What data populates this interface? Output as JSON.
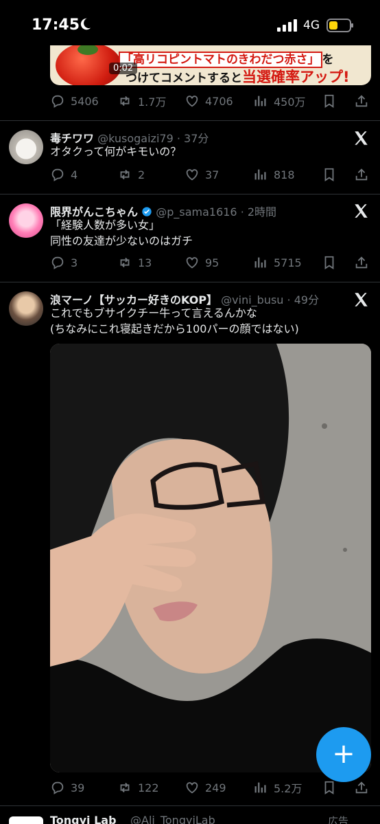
{
  "status": {
    "time": "17:45",
    "network": "4G"
  },
  "ad_tweet": {
    "image_line1_highlight": "「高リコピントマトのきわだつ赤さ」",
    "image_line1_tail": "を",
    "image_line2_pre": "つけてコメントすると",
    "image_line2_big": "当選確率アップ!",
    "video_duration": "0:02",
    "stats": {
      "replies": "5406",
      "reposts": "1.7万",
      "likes": "4706",
      "views": "450万"
    }
  },
  "tweets": [
    {
      "name": "毒チワワ",
      "handle": "@kusogaizi79",
      "time": "37分",
      "lines": [
        "オタクって何がキモいの？"
      ],
      "stats": {
        "replies": "4",
        "reposts": "2",
        "likes": "37",
        "views": "818"
      }
    },
    {
      "name": "限界がんこちゃん",
      "handle": "@p_sama1616",
      "time": "2時間",
      "lines": [
        "「経験人数が多い女」",
        "同性の友達が少ないのはガチ"
      ],
      "stats": {
        "replies": "3",
        "reposts": "13",
        "likes": "95",
        "views": "5715"
      }
    },
    {
      "name": "浪マーノ【サッカー好きのKOP】",
      "handle": "@vini_busu",
      "time": "49分",
      "lines": [
        "これでもブサイクチー牛って言えるんかな",
        "(ちなみにこれ寝起きだから100パーの顔ではない)"
      ],
      "stats": {
        "replies": "39",
        "reposts": "122",
        "likes": "249",
        "views": "5.2万"
      }
    }
  ],
  "next_tweet": {
    "name": "Tongyi Lab",
    "handle": "@Ali_TongyiLab",
    "ad_label": "広告"
  },
  "colors": {
    "accent": "#1d9bf0",
    "muted": "#71767b",
    "text": "#e7e9ea",
    "background": "#000000"
  }
}
